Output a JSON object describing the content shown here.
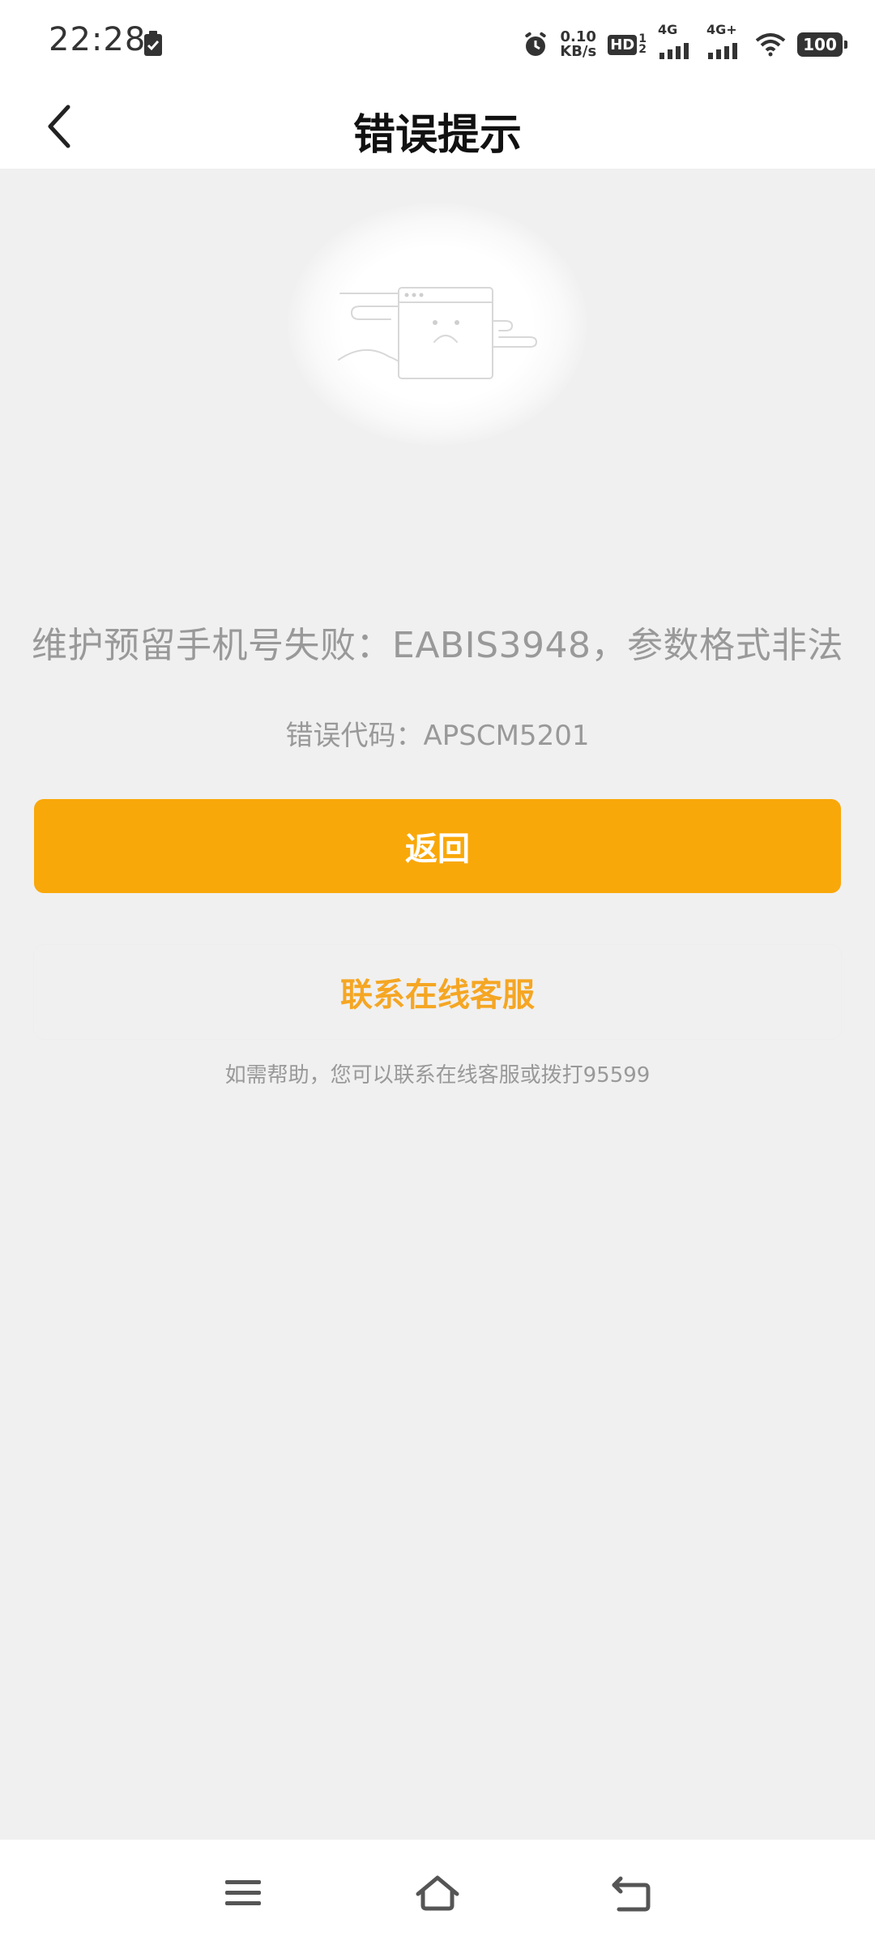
{
  "status_bar": {
    "time": "22:28",
    "net_speed_value": "0.10",
    "net_speed_unit": "KB/s",
    "hd_label": "HD",
    "sim1_network": "4G",
    "sim2_network": "4G+",
    "battery_level": "100",
    "icons": [
      "battery-saver-icon",
      "alarm-icon",
      "hd-icon",
      "signal-icon",
      "wifi-icon",
      "battery-icon"
    ]
  },
  "header": {
    "title": "错误提示",
    "back_icon": "chevron-left-icon"
  },
  "error": {
    "message": "维护预留手机号失败：EABIS3948，参数格式非法",
    "code_text": "错误代码：APSCM5201"
  },
  "actions": {
    "return_label": "返回",
    "contact_label": "联系在线客服",
    "help_text": "如需帮助，您可以联系在线客服或拨打95599"
  },
  "colors": {
    "accent": "#f9a80a",
    "accent_text": "#f5a623",
    "muted_text": "#999999",
    "background": "#f0f0f0"
  },
  "nav_bar": {
    "icons": [
      "menu-icon",
      "home-icon",
      "back-icon"
    ]
  }
}
